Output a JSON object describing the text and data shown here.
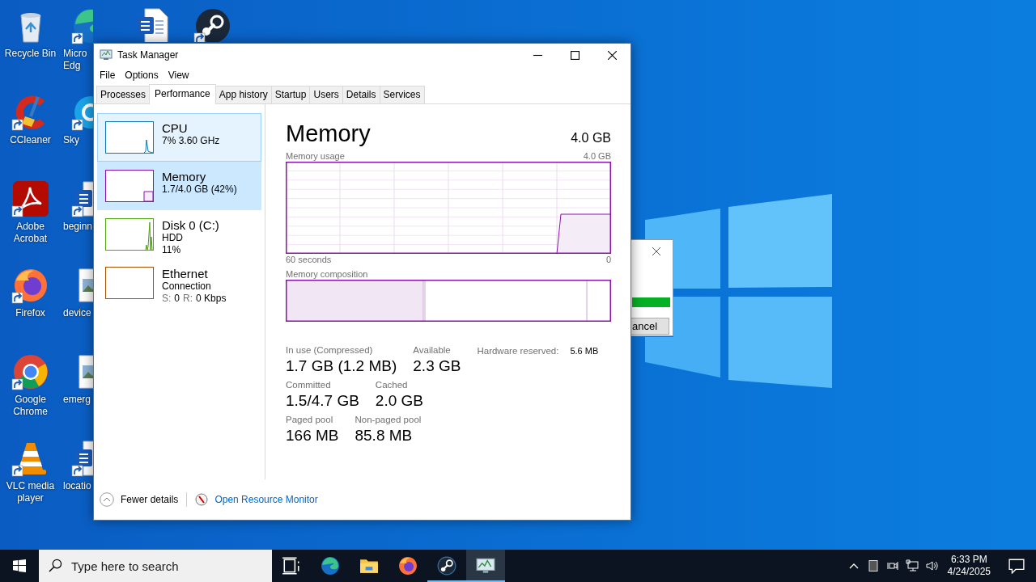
{
  "wallpaper": {
    "kind": "logo"
  },
  "desktop_columns": [
    [
      {
        "kind": "recycle",
        "shortcut": false,
        "lines": [
          "Recycle Bin"
        ]
      },
      {
        "kind": "cleaner",
        "shortcut": true,
        "lines": [
          "CCleaner"
        ]
      },
      {
        "kind": "pdf",
        "shortcut": true,
        "lines": [
          "Adobe",
          "Acrobat"
        ]
      },
      {
        "kind": "firefox",
        "shortcut": true,
        "lines": [
          "Firefox"
        ]
      },
      {
        "kind": "chrome",
        "shortcut": true,
        "lines": [
          "Google",
          "Chrome"
        ]
      },
      {
        "kind": "vlc",
        "shortcut": true,
        "lines": [
          "VLC media",
          "player"
        ]
      }
    ],
    [
      {
        "kind": "edge",
        "shortcut": true,
        "lines": [
          "Micro",
          "Edg"
        ]
      },
      {
        "kind": "skype",
        "shortcut": true,
        "lines": [
          "Sky"
        ]
      },
      {
        "kind": "word",
        "shortcut": true,
        "lines": [
          "beginn"
        ]
      },
      {
        "kind": "image",
        "shortcut": false,
        "lines": [
          "device"
        ]
      },
      {
        "kind": "image",
        "shortcut": false,
        "lines": [
          "emerg"
        ]
      },
      {
        "kind": "word",
        "shortcut": true,
        "lines": [
          "locatio"
        ]
      }
    ],
    [
      {
        "kind": "word",
        "shortcut": false
      }
    ],
    [
      {
        "kind": "steam",
        "shortcut": true
      }
    ]
  ],
  "background_dialog": {
    "progress": {
      "level": 1
    },
    "button": "ancel"
  },
  "task_manager": {
    "title": "Task Manager",
    "menu": [
      "File",
      "Options",
      "View"
    ],
    "tabs": [
      {
        "label": "Processes",
        "selected": false
      },
      {
        "label": "Performance",
        "selected": true
      },
      {
        "label": "App history",
        "selected": false
      },
      {
        "label": "Startup",
        "selected": false
      },
      {
        "label": "Users",
        "selected": false
      },
      {
        "label": "Details",
        "selected": false
      },
      {
        "label": "Services",
        "selected": false
      }
    ],
    "resources": [
      {
        "kind": "cpu",
        "name": "CPU",
        "lines": [
          "7% 3.60 GHz"
        ],
        "color": "#1178b5",
        "selected": false,
        "hovered": true
      },
      {
        "kind": "memory",
        "name": "Memory",
        "lines": [
          "1.7/4.0 GB (42%)"
        ],
        "color": "#8b12ae",
        "selected": true,
        "hovered": false
      },
      {
        "kind": "disk",
        "name": "Disk 0 (C:)",
        "lines": [
          "HDD",
          "11%"
        ],
        "color": "#4da60c",
        "selected": false,
        "hovered": false
      },
      {
        "kind": "ethernet",
        "name": "Ethernet",
        "lines": [
          "Connection"
        ],
        "rates": [
          {
            "label": "S:",
            "value": "0"
          },
          {
            "label": "R:",
            "value": "0 Kbps"
          }
        ],
        "color": "#a74f01",
        "selected": false,
        "hovered": false
      }
    ],
    "detail": {
      "title": "Memory",
      "total": "4.0 GB",
      "usage_label": "Memory usage",
      "usage_max": "4.0 GB",
      "time_span": "60 seconds",
      "time_end": "0",
      "composition_label": "Memory composition",
      "stats": [
        [
          {
            "kind": "big",
            "label": "In use (Compressed)",
            "value": "1.7 GB (1.2 MB)"
          },
          {
            "kind": "big",
            "label": "Available",
            "value": "2.3 GB"
          },
          {
            "kind": "inline",
            "label": "Hardware reserved:",
            "value": "5.6 MB"
          }
        ],
        [
          {
            "kind": "big",
            "label": "Committed",
            "value": "1.5/4.7 GB"
          },
          {
            "kind": "big",
            "label": "Cached",
            "value": "2.0 GB"
          }
        ],
        [
          {
            "kind": "big",
            "label": "Paged pool",
            "value": "166 MB"
          },
          {
            "kind": "big",
            "label": "Non-paged pool",
            "value": "85.8 MB"
          }
        ]
      ]
    },
    "footer": {
      "fewer_details": "Fewer details",
      "resource_monitor": "Open Resource Monitor"
    }
  },
  "taskbar": {
    "search_placeholder": "Type here to search",
    "apps": [
      {
        "kind": "taskview",
        "running": false,
        "active": false
      },
      {
        "kind": "edge",
        "running": false,
        "active": false
      },
      {
        "kind": "explorer",
        "running": false,
        "active": false
      },
      {
        "kind": "firefox",
        "running": false,
        "active": false
      },
      {
        "kind": "steam",
        "running": true,
        "active": false
      },
      {
        "kind": "taskmgr",
        "running": true,
        "active": true
      }
    ],
    "tray": [
      {
        "kind": "chevron"
      },
      {
        "kind": "box"
      },
      {
        "kind": "meet"
      },
      {
        "kind": "network"
      },
      {
        "kind": "volume"
      }
    ],
    "time": "6:33 PM",
    "date": "4/24/2025"
  }
}
